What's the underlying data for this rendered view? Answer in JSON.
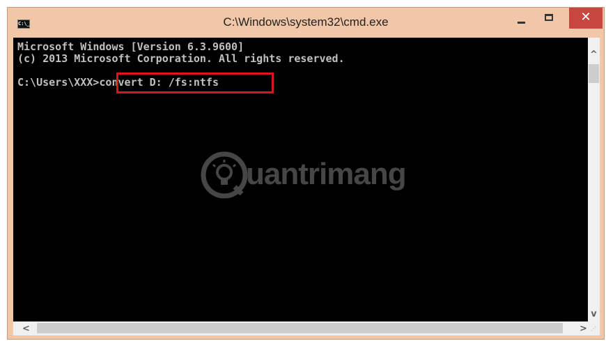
{
  "window": {
    "title": "C:\\Windows\\system32\\cmd.exe",
    "icon_label": "C:\\_",
    "close_label": "✕"
  },
  "console": {
    "line1": "Microsoft Windows [Version 6.3.9600]",
    "line2": "(c) 2013 Microsoft Corporation. All rights reserved.",
    "prompt": "C:\\Users\\XXX>",
    "command": "convert D: /fs:ntfs"
  },
  "watermark": {
    "text": "uantrimang"
  },
  "scroll": {
    "up": "^",
    "down": "v",
    "left": "<",
    "right": ">"
  },
  "colors": {
    "titlebar": "#f2c7a8",
    "console_bg": "#000000",
    "console_text": "#c0c0c0",
    "highlight_border": "#d8171a",
    "close_button": "#c7463f"
  }
}
